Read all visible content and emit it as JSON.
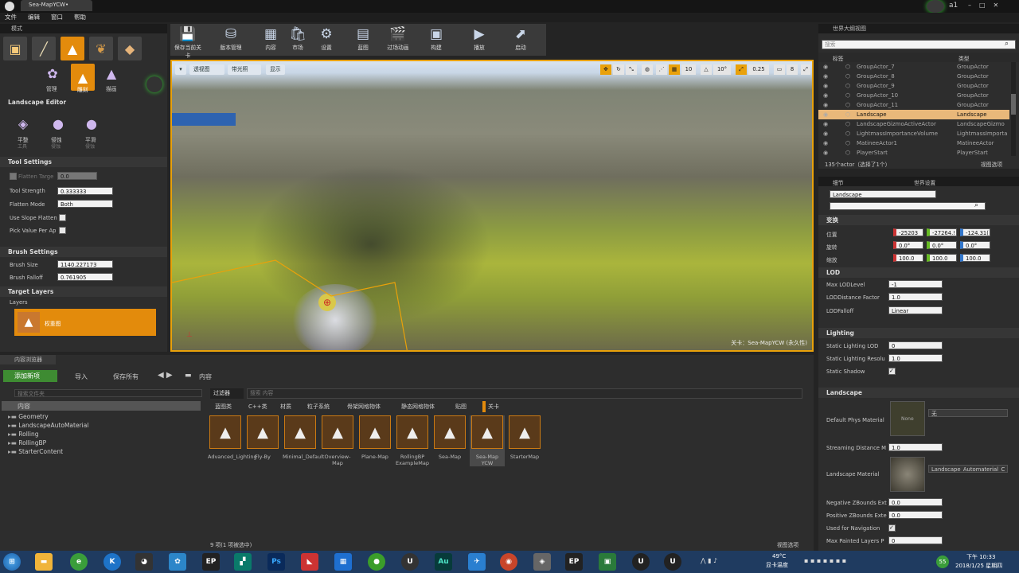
{
  "window": {
    "tab": "Sea-MapYCW•",
    "user": "a1"
  },
  "menu": [
    "文件",
    "编辑",
    "窗口",
    "帮助"
  ],
  "modes": {
    "header": "模式",
    "mode_labels": [
      "管理",
      "雕刻",
      "描画"
    ]
  },
  "landscape_editor": {
    "title": "Landscape Editor",
    "tools": [
      {
        "label": "平整",
        "sub": "工具"
      },
      {
        "label": "侵蚀",
        "sub": "侵蚀"
      },
      {
        "label": "平滑",
        "sub": "侵蚀"
      }
    ]
  },
  "tool_settings": {
    "title": "Tool Settings",
    "flatten_target": "Flatten Targe",
    "flatten_target_val": "0.0",
    "tool_strength": "Tool Strength",
    "tool_strength_val": "0.333333",
    "flatten_mode": "Flatten Mode",
    "flatten_mode_val": "Both",
    "use_slope": "Use Slope Flatten",
    "pick_value": "Pick Value Per Ap"
  },
  "brush_settings": {
    "title": "Brush Settings",
    "size": "Brush Size",
    "size_val": "1140.227173",
    "falloff": "Brush Falloff",
    "falloff_val": "0.761905"
  },
  "target_layers": {
    "title": "Target Layers",
    "layers_label": "Layers",
    "layer_name": "权重图"
  },
  "toolbar": [
    {
      "label": "保存当前关卡",
      "icon": "💾"
    },
    {
      "label": "版本管理",
      "icon": "⛁"
    },
    {
      "label": "内容",
      "icon": "▦"
    },
    {
      "label": "市场",
      "icon": "🛍"
    },
    {
      "label": "设置",
      "icon": "⚙"
    },
    {
      "label": "蓝图",
      "icon": "▤"
    },
    {
      "label": "过场动画",
      "icon": "🎬"
    },
    {
      "label": "构建",
      "icon": "▣"
    },
    {
      "label": "播放",
      "icon": "▶"
    },
    {
      "label": "启动",
      "icon": "⬈"
    }
  ],
  "viewport": {
    "perspective": "透视图",
    "lit": "带光照",
    "show": "显示",
    "grid": "10",
    "rot": "10°",
    "scale": "0.25",
    "cam": "8",
    "level_label": "关卡：Sea-MapYCW (永久性)"
  },
  "outliner": {
    "title": "世界大纲视图",
    "search_placeholder": "搜索",
    "col_label": "标签",
    "col_type": "类型",
    "rows": [
      {
        "name": "GroupActor_7",
        "type": "GroupActor",
        "sel": false
      },
      {
        "name": "GroupActor_8",
        "type": "GroupActor",
        "sel": false
      },
      {
        "name": "GroupActor_9",
        "type": "GroupActor",
        "sel": false
      },
      {
        "name": "GroupActor_10",
        "type": "GroupActor",
        "sel": false
      },
      {
        "name": "GroupActor_11",
        "type": "GroupActor",
        "sel": false
      },
      {
        "name": "Landscape",
        "type": "Landscape",
        "sel": true
      },
      {
        "name": "LandscapeGizmoActiveActor",
        "type": "LandscapeGizmo",
        "sel": false
      },
      {
        "name": "LightmassImportanceVolume",
        "type": "LightmassImporta",
        "sel": false
      },
      {
        "name": "MatineeActor1",
        "type": "MatineeActor",
        "sel": false
      },
      {
        "name": "PlayerStart",
        "type": "PlayerStart",
        "sel": false
      }
    ],
    "count": "135个actor（选择了1个）",
    "view_options": "视图选项"
  },
  "details": {
    "tab1": "细节",
    "tab2": "世界设置",
    "actor_name": "Landscape",
    "transform": "变换",
    "loc_label": "位置",
    "rot_label": "旋转",
    "scale_label": "缩放",
    "loc": [
      "-25203",
      "-27264.!",
      "-124.31("
    ],
    "rot": [
      "0.0°",
      "0.0°",
      "0.0°"
    ],
    "scale": [
      "100.0",
      "100.0",
      "100.0"
    ],
    "lod": "LOD",
    "max_lod": "Max LODLevel",
    "max_lod_val": "-1",
    "lod_dist": "LODDistance Factor",
    "lod_dist_val": "1.0",
    "lod_falloff": "LODFalloff",
    "lod_falloff_val": "Linear",
    "lighting": "Lighting",
    "static_lod": "Static Lighting LOD",
    "static_lod_val": "0",
    "static_res": "Static Lighting Resolu",
    "static_res_val": "1.0",
    "static_shadow": "Static Shadow",
    "landscape": "Landscape",
    "phys_mat": "Default Phys Material",
    "phys_none": "None",
    "phys_val": "无",
    "stream": "Streaming Distance M",
    "stream_val": "1.0",
    "land_mat": "Landscape Material",
    "land_mat_val": "Landscape_Automaterial_C",
    "neg_z": "Negative ZBounds Ext",
    "neg_z_val": "0.0",
    "pos_z": "Positive ZBounds Exte",
    "pos_z_val": "0.0",
    "nav": "Used for Navigation",
    "max_painted": "Max Painted Layers P",
    "max_painted_val": "0"
  },
  "content_browser": {
    "tab": "内容浏览器",
    "add_new": "添加新项",
    "import": "导入",
    "save_all": "保存所有",
    "path": "内容",
    "folder_search": "搜索文件夹",
    "root": "内容",
    "folders": [
      "Geometry",
      "LandscapeAutoMaterial",
      "Rolling",
      "RollingBP",
      "StarterContent"
    ],
    "filter": "过滤器",
    "search": "搜索 内容",
    "filters": [
      "蓝图类",
      "C++类",
      "材质",
      "粒子系统",
      "骨架网格物体",
      "静态网格物体",
      "贴图",
      "关卡"
    ],
    "assets": [
      "Advanced_Lighting",
      "Fly-By",
      "Minimal_Default",
      "Overview-Map",
      "Plane-Map",
      "RollingBP ExampleMap",
      "Sea-Map",
      "Sea-Map YCW",
      "StarterMap"
    ],
    "status": "9 项(1 项被选中)",
    "view_options": "视图选项"
  },
  "taskbar": {
    "temp": "49°C",
    "temp_label": "显卡温度",
    "time": "下午 10:33",
    "date": "2018/1/25 星期四",
    "badge": "55"
  }
}
